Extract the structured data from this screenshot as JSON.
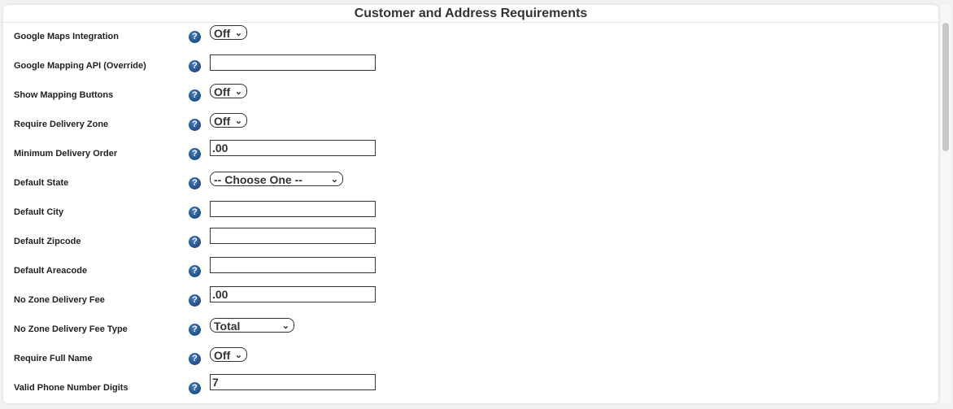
{
  "panel": {
    "title": "Customer and Address Requirements"
  },
  "help_icon_glyph": "?",
  "select_chevron": "⌄",
  "rows": [
    {
      "label": "Google Maps Integration",
      "control": "select",
      "value": "Off"
    },
    {
      "label": "Google Mapping API (Override)",
      "control": "text",
      "value": ""
    },
    {
      "label": "Show Mapping Buttons",
      "control": "select",
      "value": "Off"
    },
    {
      "label": "Require Delivery Zone",
      "control": "select",
      "value": "Off"
    },
    {
      "label": "Minimum Delivery Order",
      "control": "text",
      "value": ".00"
    },
    {
      "label": "Default State",
      "control": "select",
      "value": "-- Choose One --"
    },
    {
      "label": "Default City",
      "control": "text",
      "value": ""
    },
    {
      "label": "Default Zipcode",
      "control": "text",
      "value": ""
    },
    {
      "label": "Default Areacode",
      "control": "text",
      "value": ""
    },
    {
      "label": "No Zone Delivery Fee",
      "control": "text",
      "value": ".00"
    },
    {
      "label": "No Zone Delivery Fee Type",
      "control": "select",
      "value": "Total"
    },
    {
      "label": "Require Full Name",
      "control": "select",
      "value": "Off"
    },
    {
      "label": "Valid Phone Number Digits",
      "control": "text",
      "value": "7"
    }
  ],
  "colors": {
    "help_icon": "#1f4e8c",
    "panel_bg": "#ffffff",
    "page_bg": "#f2f2f2"
  }
}
